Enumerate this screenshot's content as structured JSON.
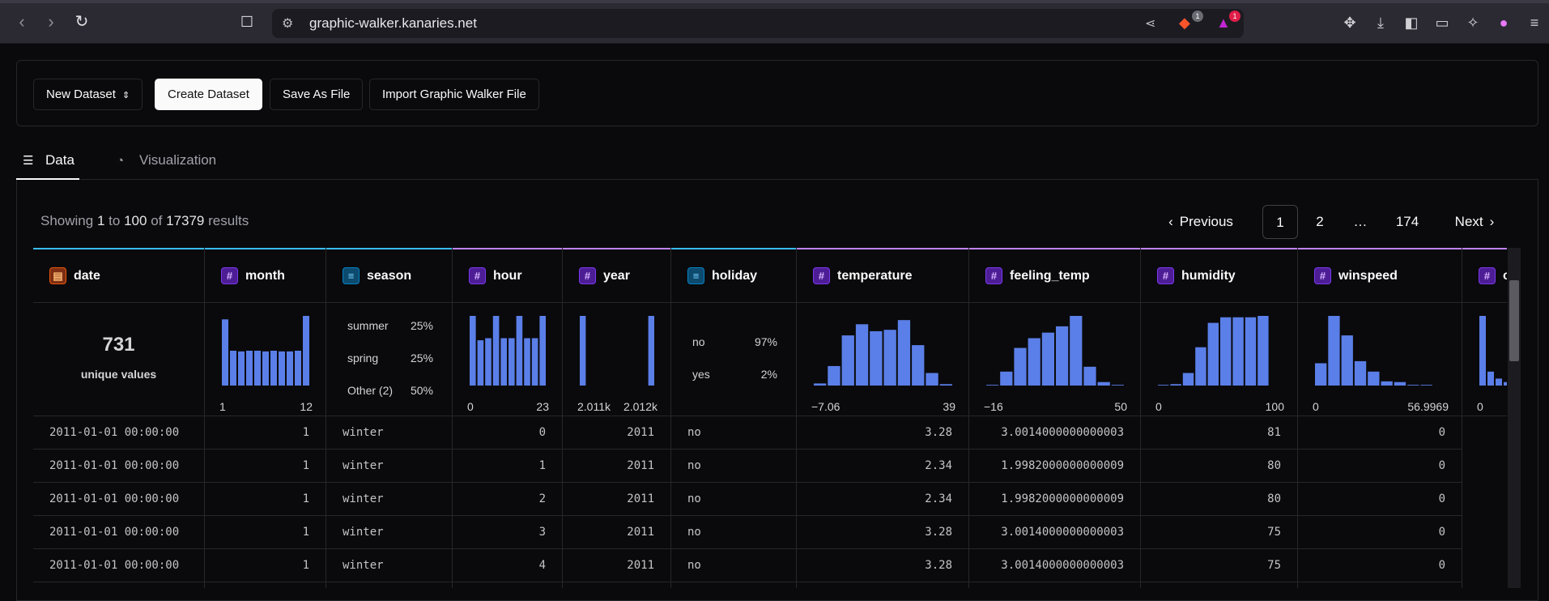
{
  "browser": {
    "url": "graphic-walker.kanaries.net",
    "brave_badge": "1",
    "alert_badge": "1"
  },
  "toolbar": {
    "dataset_select": "New Dataset",
    "create_label": "Create Dataset",
    "save_label": "Save As File",
    "import_label": "Import Graphic Walker File"
  },
  "tabs": {
    "data": "Data",
    "visualization": "Visualization"
  },
  "results": {
    "prefix": "Showing",
    "from": "1",
    "to_word": "to",
    "to": "100",
    "of_word": "of",
    "total": "17379",
    "suffix": "results"
  },
  "pagination": {
    "previous": "Previous",
    "pages": [
      "1",
      "2",
      "…",
      "174"
    ],
    "next": "Next"
  },
  "columns": [
    {
      "name": "date",
      "type": "date",
      "accent": "#38bdf8"
    },
    {
      "name": "month",
      "type": "number",
      "accent": "#38bdf8"
    },
    {
      "name": "season",
      "type": "category",
      "accent": "#38bdf8"
    },
    {
      "name": "hour",
      "type": "number",
      "accent": "#c084fc"
    },
    {
      "name": "year",
      "type": "number",
      "accent": "#c084fc"
    },
    {
      "name": "holiday",
      "type": "category",
      "accent": "#38bdf8"
    },
    {
      "name": "temperature",
      "type": "number",
      "accent": "#c084fc"
    },
    {
      "name": "feeling_temp",
      "type": "number",
      "accent": "#c084fc"
    },
    {
      "name": "humidity",
      "type": "number",
      "accent": "#c084fc"
    },
    {
      "name": "winspeed",
      "type": "number",
      "accent": "#c084fc"
    },
    {
      "name": "ca",
      "type": "number",
      "accent": "#c084fc"
    }
  ],
  "stats": {
    "date": {
      "count": "731",
      "label": "unique values"
    },
    "month": {
      "min": "1",
      "max": "12",
      "bins": [
        0.95,
        0.5,
        0.49,
        0.5,
        0.5,
        0.49,
        0.5,
        0.49,
        0.49,
        0.5,
        1.0
      ]
    },
    "season": {
      "rows": [
        {
          "label": "summer",
          "pct": "25%"
        },
        {
          "label": "spring",
          "pct": "25%"
        },
        {
          "label": "Other (2)",
          "pct": "50%"
        }
      ]
    },
    "hour": {
      "min": "0",
      "max": "23",
      "bins": [
        1.0,
        0.65,
        0.68,
        1.0,
        0.68,
        0.68,
        1.0,
        0.68,
        0.68,
        1.0
      ]
    },
    "year": {
      "min": "2.011k",
      "max": "2.012k",
      "bins": [
        1.0,
        0,
        0,
        0,
        0,
        0,
        0,
        0,
        0,
        1.0
      ]
    },
    "holiday": {
      "rows": [
        {
          "label": "no",
          "pct": "97%"
        },
        {
          "label": "yes",
          "pct": "2%"
        }
      ]
    },
    "temperature": {
      "min": "−7.06",
      "max": "39",
      "bins": [
        0.03,
        0.28,
        0.72,
        0.88,
        0.78,
        0.8,
        0.94,
        0.58,
        0.18,
        0.02
      ]
    },
    "feeling_temp": {
      "min": "−16",
      "max": "50",
      "bins": [
        0.01,
        0.2,
        0.54,
        0.68,
        0.76,
        0.85,
        1.0,
        0.27,
        0.05,
        0.01
      ]
    },
    "humidity": {
      "min": "0",
      "max": "100",
      "bins": [
        0.01,
        0.02,
        0.18,
        0.55,
        0.9,
        0.98,
        0.98,
        0.98,
        1.0,
        0.0
      ]
    },
    "winspeed": {
      "min": "0",
      "max": "56.9969",
      "bins": [
        0.32,
        1.0,
        0.72,
        0.35,
        0.2,
        0.06,
        0.05,
        0.01,
        0.01,
        0.0
      ]
    },
    "ca": {
      "min": "0",
      "bins": [
        1.0,
        0.2,
        0.1,
        0.05
      ]
    }
  },
  "rows": [
    {
      "date": "2011-01-01 00:00:00",
      "month": "1",
      "season": "winter",
      "hour": "0",
      "year": "2011",
      "holiday": "no",
      "temperature": "3.28",
      "feeling_temp": "3.0014000000000003",
      "humidity": "81",
      "winspeed": "0"
    },
    {
      "date": "2011-01-01 00:00:00",
      "month": "1",
      "season": "winter",
      "hour": "1",
      "year": "2011",
      "holiday": "no",
      "temperature": "2.34",
      "feeling_temp": "1.9982000000000009",
      "humidity": "80",
      "winspeed": "0"
    },
    {
      "date": "2011-01-01 00:00:00",
      "month": "1",
      "season": "winter",
      "hour": "2",
      "year": "2011",
      "holiday": "no",
      "temperature": "2.34",
      "feeling_temp": "1.9982000000000009",
      "humidity": "80",
      "winspeed": "0"
    },
    {
      "date": "2011-01-01 00:00:00",
      "month": "1",
      "season": "winter",
      "hour": "3",
      "year": "2011",
      "holiday": "no",
      "temperature": "3.28",
      "feeling_temp": "3.0014000000000003",
      "humidity": "75",
      "winspeed": "0"
    },
    {
      "date": "2011-01-01 00:00:00",
      "month": "1",
      "season": "winter",
      "hour": "4",
      "year": "2011",
      "holiday": "no",
      "temperature": "3.28",
      "feeling_temp": "3.0014000000000003",
      "humidity": "75",
      "winspeed": "0"
    }
  ]
}
